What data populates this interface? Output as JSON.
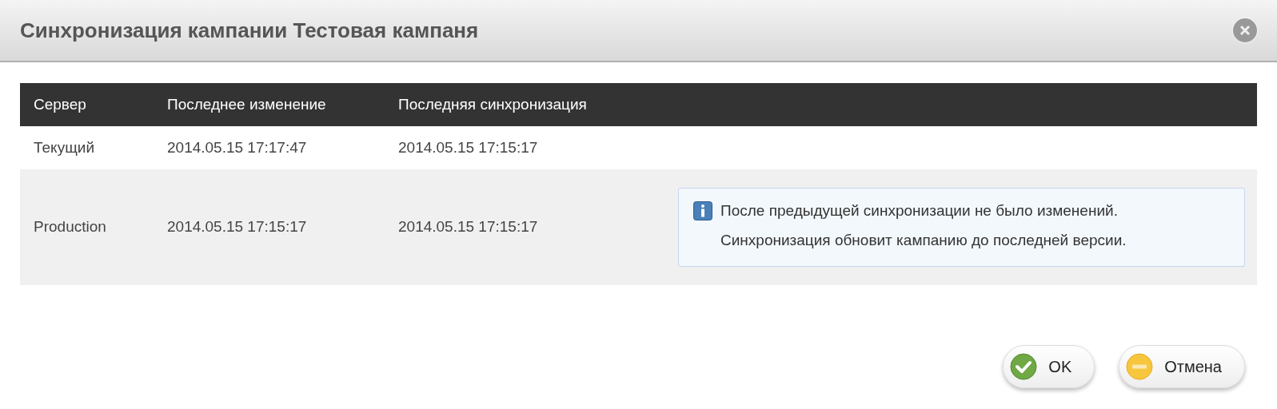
{
  "window": {
    "title": "Синхронизация кампании Тестовая кампаня"
  },
  "table": {
    "columns": [
      "Сервер",
      "Последнее изменение",
      "Последняя синхронизация"
    ],
    "rows": [
      {
        "cells": [
          "Текущий",
          "2014.05.15 17:17:47",
          "2014.05.15 17:15:17"
        ]
      },
      {
        "cells": [
          "Production",
          "2014.05.15 17:15:17",
          "2014.05.15 17:15:17"
        ],
        "notice": "После предыдущей синхронизации не было изменений. Синхронизация обновит кампанию до последней версии."
      }
    ]
  },
  "buttons": [
    {
      "kind": "ok",
      "label": "OK"
    },
    {
      "kind": "cancel",
      "label": "Отмена"
    }
  ]
}
